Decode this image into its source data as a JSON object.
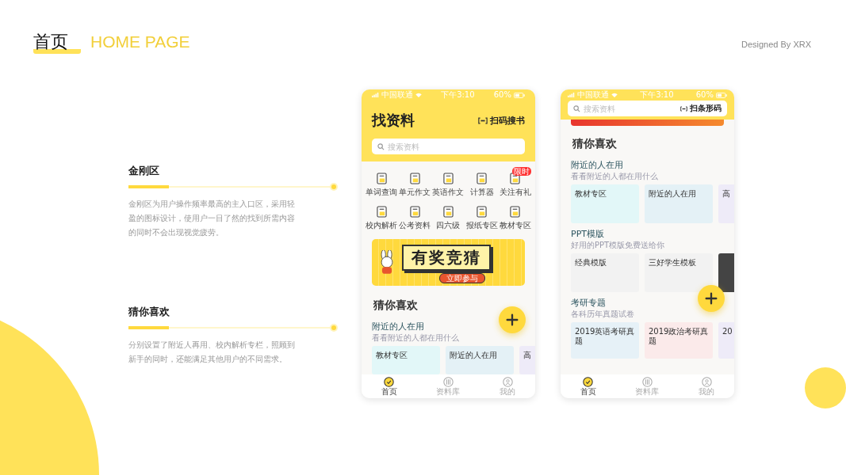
{
  "header": {
    "title": "首页",
    "subtitle": "HOME PAGE",
    "credit": "Designed By XRX"
  },
  "notes": [
    {
      "title": "金刚区",
      "body": "金刚区为用户操作频率最高的主入口区，采用轻盈的图标设计，使用户一目了然的找到所需内容的同时不会出现视觉疲劳。"
    },
    {
      "title": "猜你喜欢",
      "body": "分别设置了附近人再用、校内解析专栏，照顾到新手的同时，还能满足其他用户的不同需求。"
    }
  ],
  "phones": [
    {
      "kind": "home",
      "status": {
        "carrier": "中国联通",
        "time": "下午3:10",
        "battery": "60%"
      },
      "title": "找资料",
      "scan_label": "扫码搜书",
      "search_placeholder": "搜索资料",
      "shortcuts": [
        {
          "label": "单词查询"
        },
        {
          "label": "单元作文"
        },
        {
          "label": "英语作文"
        },
        {
          "label": "计算器"
        },
        {
          "label": "关注有礼",
          "badge": "限时"
        },
        {
          "label": "校内解析"
        },
        {
          "label": "公考资料"
        },
        {
          "label": "四六级"
        },
        {
          "label": "报纸专区"
        },
        {
          "label": "教材专区"
        }
      ],
      "banner": {
        "headline": "有奖竞猜",
        "button": "立即参与"
      },
      "heading": "猜你喜欢",
      "sections": [
        {
          "title": "附近的人在用",
          "subtitle": "看看附近的人都在用什么",
          "cards": [
            {
              "label": "教材专区",
              "color": "#e2f7f8"
            },
            {
              "label": "附近的人在用",
              "color": "#e4f1f6"
            },
            {
              "label": "高",
              "color": "#eeebf8"
            }
          ]
        }
      ],
      "tabs": [
        {
          "label": "首页",
          "selected": true
        },
        {
          "label": "资料库",
          "selected": false
        },
        {
          "label": "我的",
          "selected": false
        }
      ]
    },
    {
      "kind": "scrolled",
      "status": {
        "carrier": "中国联通",
        "time": "下午3:10",
        "battery": "60%"
      },
      "scan_label": "扫条形码",
      "search_placeholder": "搜索资料",
      "heading": "猜你喜欢",
      "sections": [
        {
          "title": "附近的人在用",
          "subtitle": "看看附近的人都在用什么",
          "cards": [
            {
              "label": "教材专区",
              "color": "#e2f7f8"
            },
            {
              "label": "附近的人在用",
              "color": "#e4f1f6"
            },
            {
              "label": "高",
              "color": "#eeebf8"
            }
          ]
        },
        {
          "title": "PPT模版",
          "subtitle": "好用的PPT模版免费送给你",
          "cards": [
            {
              "label": "经典模版",
              "color": "#f2f2f2"
            },
            {
              "label": "三好学生模板",
              "color": "#f2f2f2"
            },
            {
              "color": "#444444"
            }
          ]
        },
        {
          "title": "考研专题",
          "subtitle": "各科历年真题试卷",
          "cards": [
            {
              "label": "2019英语考研真题",
              "color": "#e6f1f7"
            },
            {
              "label": "2019政治考研真题",
              "color": "#fbeaea"
            },
            {
              "label": "20",
              "color": "#eeebf8"
            }
          ]
        }
      ],
      "tabs": [
        {
          "label": "首页",
          "selected": true
        },
        {
          "label": "资料库",
          "selected": false
        },
        {
          "label": "我的",
          "selected": false
        }
      ]
    }
  ]
}
